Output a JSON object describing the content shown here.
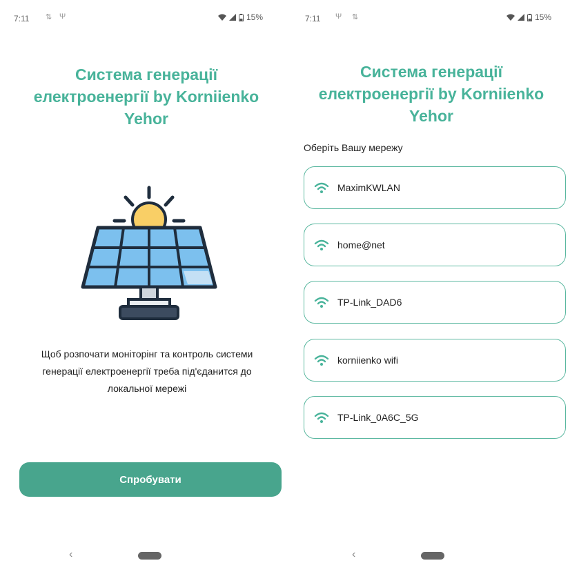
{
  "colors": {
    "accent": "#48b39a",
    "button": "#48a58d",
    "border": "#5bb8a0"
  },
  "left": {
    "status": {
      "time": "7:11",
      "battery": "15%"
    },
    "title_lines": [
      "Система генерації",
      "електроенергії by Korniienko",
      "Yehor"
    ],
    "illustration_icon": "solar-panel-sun-icon",
    "description_lines": [
      "Щоб розпочати моніторінг та контроль системи",
      "генерації електроенергії треба під'єданится до",
      "локальної мережі"
    ],
    "button_label": "Спробувати",
    "nav": {
      "back": "‹"
    }
  },
  "right": {
    "status": {
      "time": "7:11",
      "battery": "15%"
    },
    "title_lines": [
      "Система генерації",
      "електроенергії by Korniienko",
      "Yehor"
    ],
    "section_label": "Оберіть Вашу мережу",
    "networks": [
      "MaximKWLAN",
      "home@net",
      "TP-Link_DAD6",
      "korniienko wifi",
      "TP-Link_0A6C_5G"
    ],
    "nav": {
      "back": "‹"
    }
  }
}
